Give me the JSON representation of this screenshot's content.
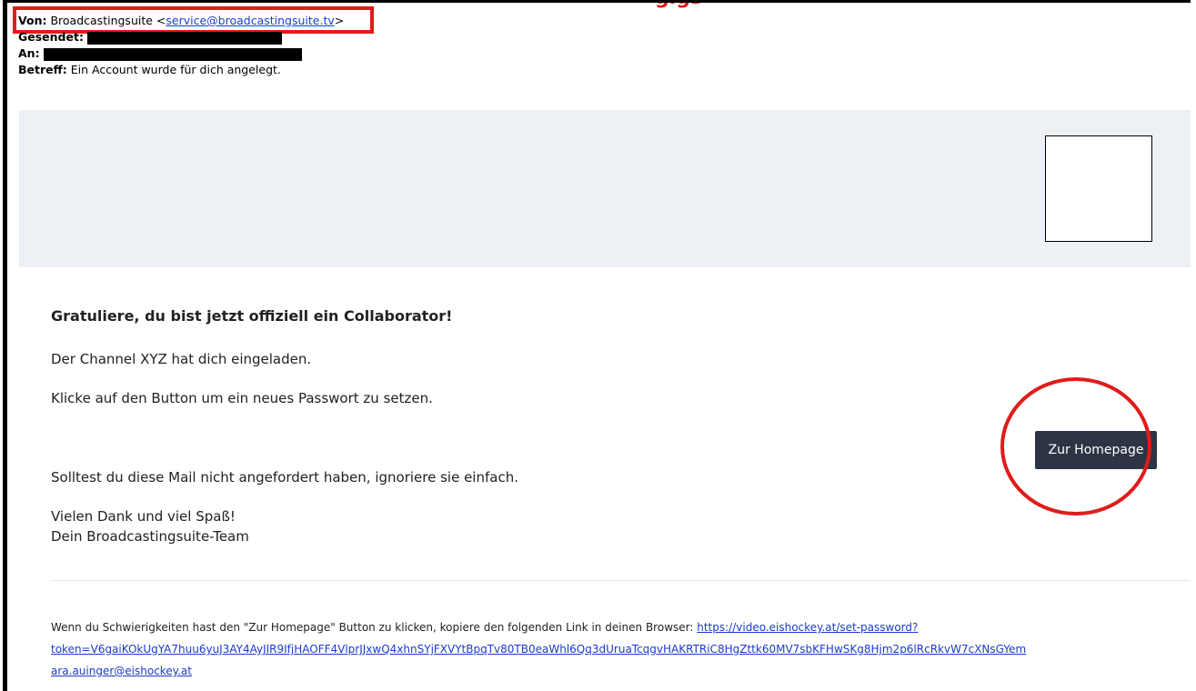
{
  "email": {
    "from_label": "Von:",
    "from_name": "Broadcastingsuite <",
    "from_email": "service@broadcastingsuite.tv",
    "from_close": ">",
    "sent_label": "Gesendet:",
    "to_label": "An:",
    "subject_label": "Betreff:",
    "subject": "Ein Account wurde für dich angelegt."
  },
  "body": {
    "headline": "Gratuliere, du bist jetzt offiziell ein Collaborator!",
    "invite_text": "Der Channel XYZ hat dich eingeladen.",
    "instruction_text": "Klicke auf den Button um ein neues Passwort zu setzen.",
    "button_label": "Zur Homepage",
    "ignore_text": "Solltest du diese Mail nicht angefordert haben, ignoriere sie einfach.",
    "thanks_text": "Vielen Dank und viel Spaß!",
    "signature": "Dein Broadcastingsuite-Team"
  },
  "footer": {
    "trouble_text": "Wenn du Schwierigkeiten hast den \"Zur Homepage\" Button zu klicken, kopiere den folgenden Link in deinen Browser:",
    "link_part1": "https://video.eishockey.at/set-password?",
    "link_part2": "token=V6gaiKOkUgYA7huu6yuJ3AY4AyJIR9IfjHAOFF4VlprJJxwQ4xhnSYjFXVYtBpqTv80TB0eaWhl6Qq3dUruaTcqgvHAKRTRiC8HgZttk60MV7sbKFHwSKg8Hjm2p6lRcRkvW7cXNsGYem",
    "link_part3": "ara.auinger@eishockey.at"
  },
  "annotations": {
    "title_fragment": "gigs"
  },
  "colors": {
    "highlight": "#e01b1b",
    "button_bg": "#2d3443",
    "banner_bg": "#edf0f4",
    "link": "#1a3ccc"
  }
}
